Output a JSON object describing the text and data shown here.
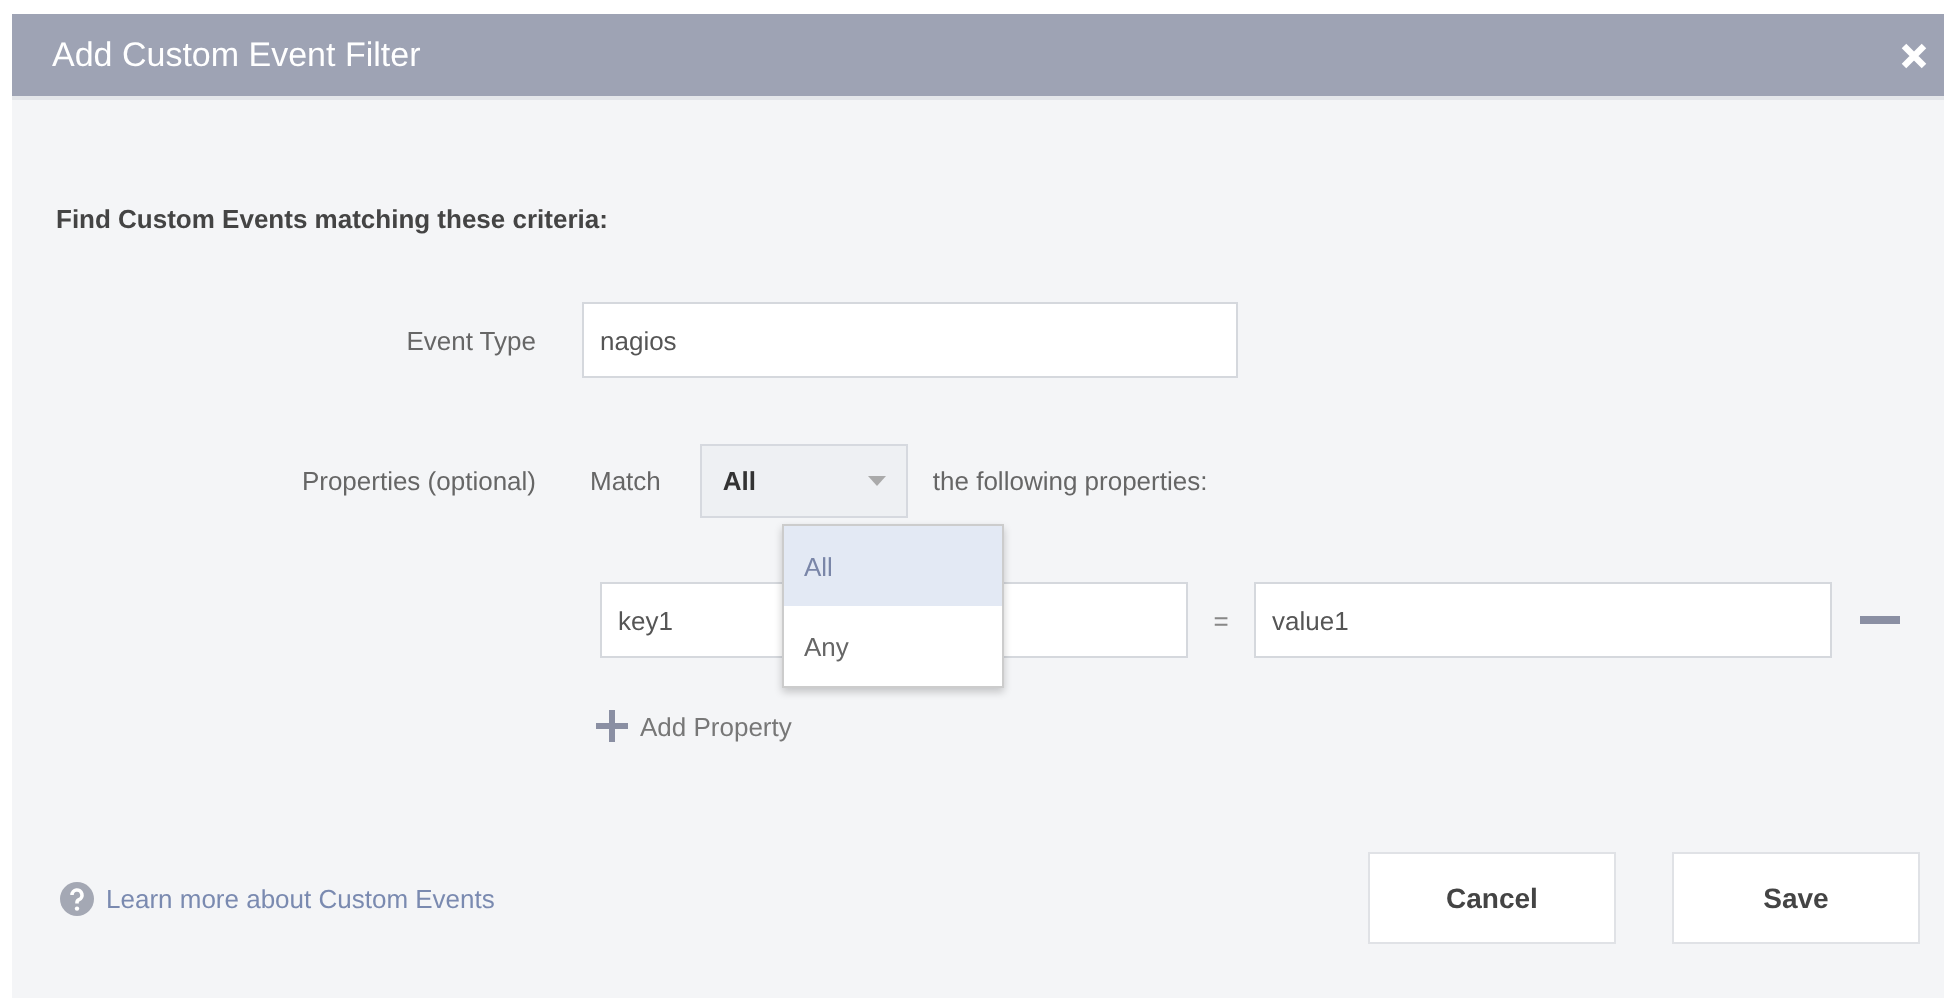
{
  "dialog": {
    "title": "Add Custom Event Filter",
    "heading": "Find Custom Events matching these criteria:",
    "event_type": {
      "label": "Event Type",
      "value": "nagios"
    },
    "properties": {
      "label": "Properties (optional)",
      "match_label": "Match",
      "match_select": {
        "value": "All",
        "expanded": true,
        "options": [
          {
            "label": "All",
            "selected": true
          },
          {
            "label": "Any",
            "selected": false
          }
        ]
      },
      "match_suffix": "the following properties:",
      "rows": [
        {
          "key": "key1",
          "operator": "=",
          "value": "value1"
        }
      ],
      "add_button": "Add Property"
    },
    "footer": {
      "help_link": "Learn more about Custom Events",
      "buttons": [
        "Cancel",
        "Save"
      ]
    }
  }
}
